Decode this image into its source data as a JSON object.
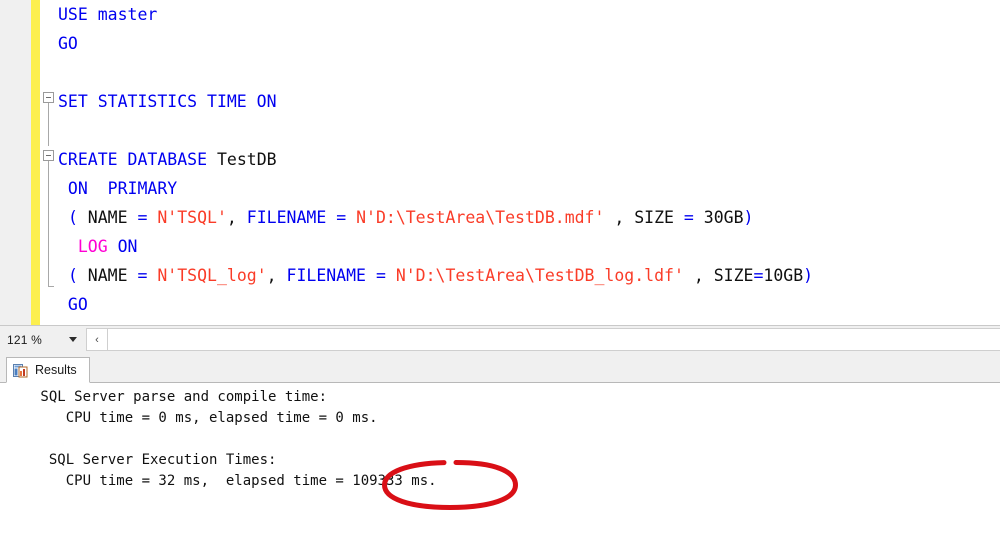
{
  "editor": {
    "zoom_level": "121 %",
    "lines": [
      {
        "id": "line-use-master",
        "indent": 0,
        "outline": "none",
        "tokens": [
          {
            "t": "USE master",
            "c": "kw"
          }
        ]
      },
      {
        "id": "line-go-1",
        "indent": 0,
        "outline": "none",
        "tokens": [
          {
            "t": "GO",
            "c": "kw"
          }
        ]
      },
      {
        "id": "line-blank-1",
        "indent": 0,
        "outline": "none",
        "tokens": []
      },
      {
        "id": "line-set-statistics",
        "indent": 0,
        "outline": "start",
        "tokens": [
          {
            "t": "SET STATISTICS TIME ON",
            "c": "kw"
          }
        ]
      },
      {
        "id": "line-blank-2",
        "indent": 0,
        "outline": "none",
        "tokens": []
      },
      {
        "id": "line-create-database",
        "indent": 0,
        "outline": "start",
        "tokens": [
          {
            "t": "CREATE DATABASE ",
            "c": "kw"
          },
          {
            "t": "TestDB",
            "c": "txt"
          }
        ]
      },
      {
        "id": "line-on-primary",
        "indent": 0,
        "outline": "none",
        "tokens": [
          {
            "t": " ON  PRIMARY",
            "c": "kw"
          }
        ]
      },
      {
        "id": "line-name-tsql",
        "indent": 0,
        "outline": "none",
        "tokens": [
          {
            "t": " ",
            "c": "txt"
          },
          {
            "t": "(",
            "c": "kw"
          },
          {
            "t": " NAME ",
            "c": "txt"
          },
          {
            "t": "=",
            "c": "kw"
          },
          {
            "t": " ",
            "c": "txt"
          },
          {
            "t": "N'TSQL'",
            "c": "str"
          },
          {
            "t": ", ",
            "c": "txt"
          },
          {
            "t": "FILENAME",
            "c": "kw"
          },
          {
            "t": " ",
            "c": "txt"
          },
          {
            "t": "=",
            "c": "kw"
          },
          {
            "t": " ",
            "c": "txt"
          },
          {
            "t": "N'D:\\TestArea\\TestDB.mdf'",
            "c": "str"
          },
          {
            "t": " , SIZE ",
            "c": "txt"
          },
          {
            "t": "=",
            "c": "kw"
          },
          {
            "t": " 30GB",
            "c": "txt"
          },
          {
            "t": ")",
            "c": "kw"
          }
        ]
      },
      {
        "id": "line-log-on",
        "indent": 0,
        "outline": "none",
        "tokens": [
          {
            "t": "  ",
            "c": "txt"
          },
          {
            "t": "LOG",
            "c": "pink"
          },
          {
            "t": " ",
            "c": "txt"
          },
          {
            "t": "ON",
            "c": "kw"
          }
        ]
      },
      {
        "id": "line-name-tsql-log",
        "indent": 0,
        "outline": "end",
        "tokens": [
          {
            "t": " ",
            "c": "txt"
          },
          {
            "t": "(",
            "c": "kw"
          },
          {
            "t": " NAME ",
            "c": "txt"
          },
          {
            "t": "=",
            "c": "kw"
          },
          {
            "t": " ",
            "c": "txt"
          },
          {
            "t": "N'TSQL_log'",
            "c": "str"
          },
          {
            "t": ", ",
            "c": "txt"
          },
          {
            "t": "FILENAME",
            "c": "kw"
          },
          {
            "t": " ",
            "c": "txt"
          },
          {
            "t": "=",
            "c": "kw"
          },
          {
            "t": " ",
            "c": "txt"
          },
          {
            "t": "N'D:\\TestArea\\TestDB_log.ldf'",
            "c": "str"
          },
          {
            "t": " , SIZE",
            "c": "txt"
          },
          {
            "t": "=",
            "c": "kw"
          },
          {
            "t": "10GB",
            "c": "txt"
          },
          {
            "t": ")",
            "c": "kw"
          }
        ]
      },
      {
        "id": "line-go-2",
        "indent": 0,
        "outline": "none",
        "tokens": [
          {
            "t": " GO",
            "c": "kw"
          }
        ]
      }
    ]
  },
  "status": {
    "zoom_label": "121 %",
    "scroll_left_glyph": "‹"
  },
  "tabs": {
    "results": {
      "label": "Results",
      "icon": "results-grid-icon",
      "active": true
    }
  },
  "results": {
    "lines": [
      " SQL Server parse and compile time:",
      "    CPU time = 0 ms, elapsed time = 0 ms.",
      "",
      "  SQL Server Execution Times:",
      "    CPU time = 32 ms,  elapsed time = 109333 ms."
    ]
  },
  "annotation": {
    "type": "ellipse",
    "color": "#d90f16",
    "target_text": "= 109333 ms.",
    "highlighted_value": "109333 ms."
  },
  "colors": {
    "keyword": "#0000f0",
    "string": "#fa3c28",
    "magenta_keyword": "#ff00d4",
    "plain_text": "#101010",
    "change_bar": "#fcef4f",
    "annotation_red": "#d90f16",
    "chrome": "#f0f0f0"
  }
}
